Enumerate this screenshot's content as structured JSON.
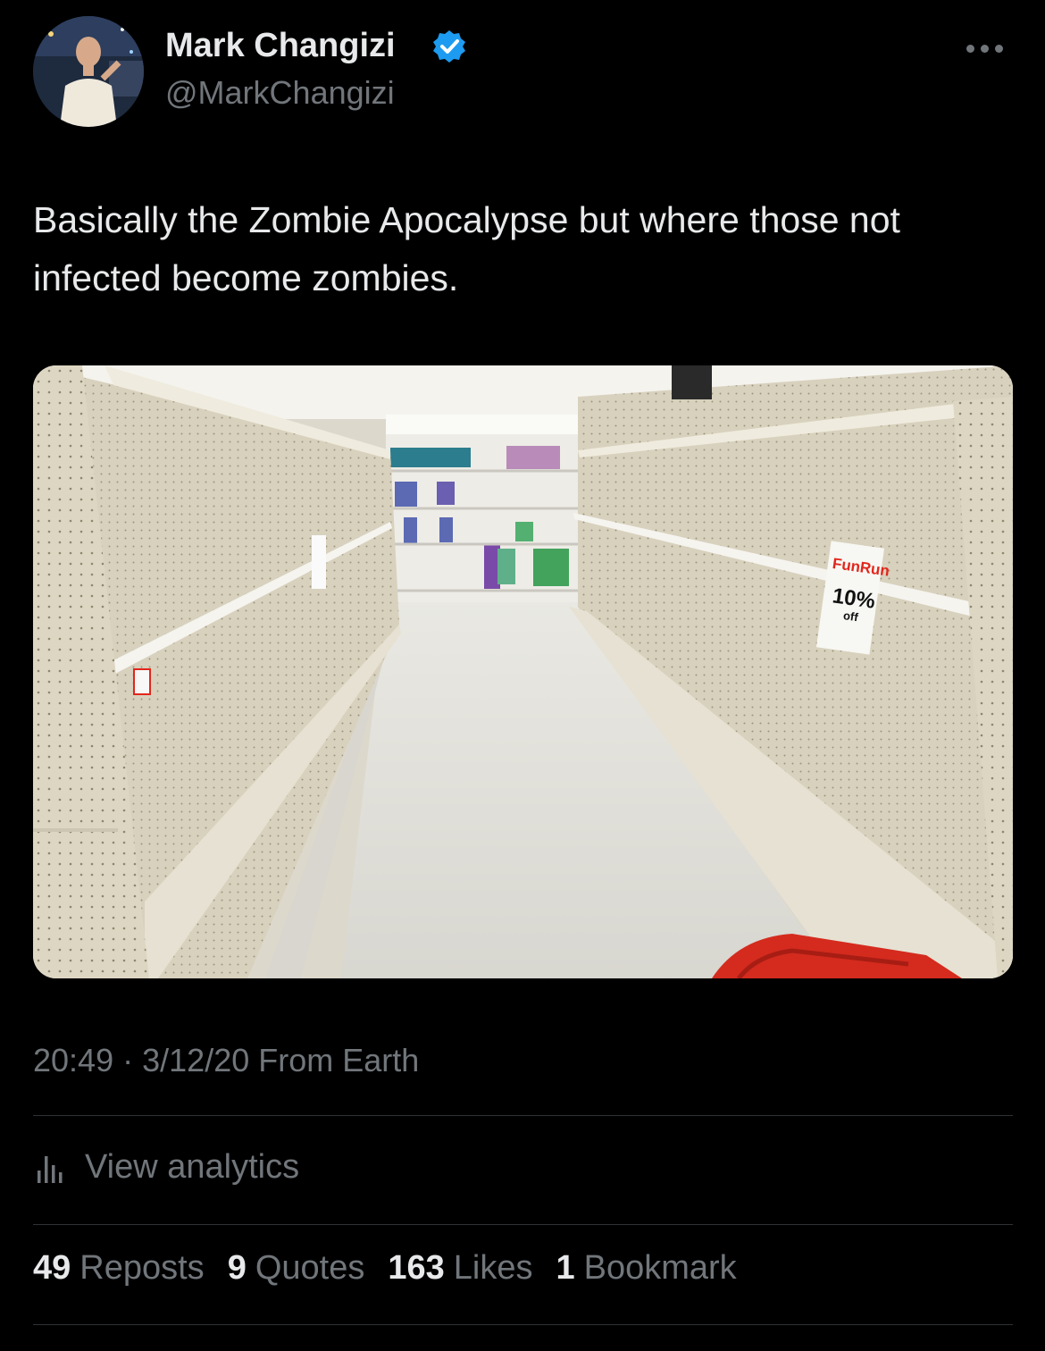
{
  "author": {
    "display_name": "Mark Changizi",
    "handle": "@MarkChangizi",
    "verified_color": "#1d9bf0"
  },
  "tweet": {
    "text": "Basically the Zombie Apocalypse but where those not infected become zombies.",
    "media": {
      "sign_brand": "FunRun",
      "sign_discount": "10%",
      "sign_off": "off"
    }
  },
  "meta": {
    "time": "20:49",
    "separator": "·",
    "date": "3/12/20",
    "source": "From Earth"
  },
  "analytics": {
    "label": "View analytics",
    "icon": "bar-chart-icon"
  },
  "stats": [
    {
      "count": "49",
      "label": "Reposts"
    },
    {
      "count": "9",
      "label": "Quotes"
    },
    {
      "count": "163",
      "label": "Likes"
    },
    {
      "count": "1",
      "label": "Bookmark"
    }
  ],
  "colors": {
    "background": "#000000",
    "primary_text": "#e7e9ea",
    "secondary_text": "#71767b",
    "divider": "#2f3336",
    "cart_red": "#d42b1e",
    "sign_red": "#e2261c"
  }
}
